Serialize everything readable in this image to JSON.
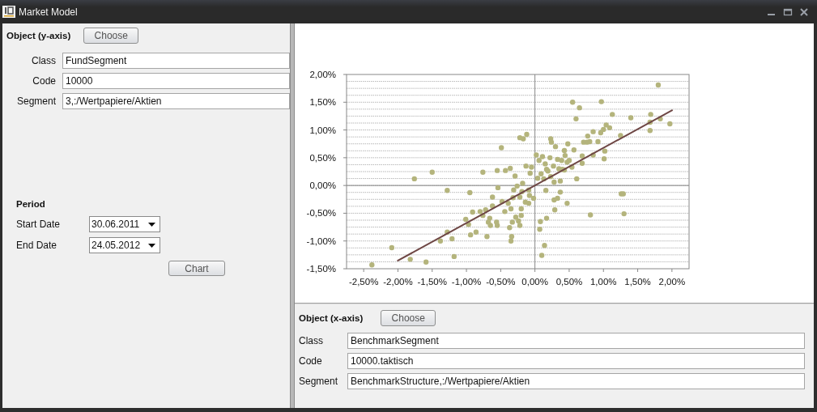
{
  "window": {
    "title": "Market Model"
  },
  "y_object": {
    "heading": "Object (y-axis)",
    "choose_button": "Choose",
    "fields": [
      {
        "label": "Class",
        "value": "FundSegment"
      },
      {
        "label": "Code",
        "value": "10000"
      },
      {
        "label": "Segment",
        "value": "3,:/Wertpapiere/Aktien"
      }
    ]
  },
  "period": {
    "heading": "Period",
    "fields": [
      {
        "label": "Start Date",
        "value": "30.06.2011"
      },
      {
        "label": "End Date",
        "value": "24.05.2012"
      }
    ],
    "chart_button": "Chart"
  },
  "chart_data": {
    "type": "scatter",
    "grid": true,
    "xlim": [
      -2.75,
      2.25
    ],
    "ylim": [
      -1.5,
      2.0
    ],
    "xticks": [
      {
        "value": -2.5,
        "label": "-2,50%"
      },
      {
        "value": -2.0,
        "label": "-2,00%"
      },
      {
        "value": -1.5,
        "label": "-1,50%"
      },
      {
        "value": -1.0,
        "label": "-1,00%"
      },
      {
        "value": -0.5,
        "label": "-0,50%"
      },
      {
        "value": 0,
        "label": "0,00%"
      },
      {
        "value": 0.5,
        "label": "0,50%"
      },
      {
        "value": 1.0,
        "label": "1,00%"
      },
      {
        "value": 1.5,
        "label": "1,50%"
      },
      {
        "value": 2.0,
        "label": "2,00%"
      }
    ],
    "yticks": [
      {
        "value": 2.0,
        "label": "2,00%"
      },
      {
        "value": 1.5,
        "label": "1,50%"
      },
      {
        "value": 1.0,
        "label": "1,00%"
      },
      {
        "value": 0.5,
        "label": "0,50%"
      },
      {
        "value": 0,
        "label": "0,00%"
      },
      {
        "value": -0.5,
        "label": "-0,50%"
      },
      {
        "value": -1.0,
        "label": "-1,00%"
      },
      {
        "value": -1.5,
        "label": "-1,50%"
      }
    ],
    "series": [
      {
        "type": "scatter",
        "color": "#b4b47c",
        "x": [
          1.8,
          0.55,
          0.97,
          0.65,
          0.6,
          1.13,
          1.4,
          1.69,
          1.83,
          1.97,
          1.68,
          1.68,
          1.25,
          1.04,
          1.09,
          1.0,
          0.96,
          0.85,
          0.77,
          0.76,
          0.8,
          0.92,
          0.71,
          0.85,
          1.01,
          1.02,
          0.48,
          0.23,
          0.3,
          0.57,
          0.43,
          0.44,
          0.69,
          0.69,
          0.54,
          0.24,
          0.02,
          0.11,
          0.22,
          0.33,
          0.39,
          0.47,
          0.15,
          0.27,
          0.35,
          0.43,
          0.19,
          0.09,
          0.04,
          0.13,
          0.23,
          0.61,
          0.37,
          0.28,
          -0.05,
          -0.13,
          -0.07,
          -0.12,
          -0.22,
          -0.17,
          -0.49,
          -0.36,
          -0.43,
          -0.55,
          -0.76,
          -0.29,
          -0.18,
          -1.5,
          -1.76,
          -1.28,
          -0.95,
          -0.54,
          -0.26,
          -0.31,
          -0.19,
          -0.08,
          -0.02,
          -0.09,
          -0.22,
          -0.32,
          -0.39,
          -0.48,
          -0.62,
          -0.62,
          -0.72,
          -0.8,
          -0.91,
          -1.01,
          -0.97,
          -0.66,
          -0.56,
          -0.44,
          -0.35,
          -0.2,
          -0.24,
          -0.28,
          -0.37,
          -0.33,
          -0.22,
          -0.2,
          -0.65,
          -0.55,
          -0.76,
          -0.68,
          -0.86,
          -0.94,
          -0.7,
          -0.34,
          -0.35,
          -1.28,
          -1.21,
          -1.38,
          -1.18,
          -2.09,
          -1.82,
          -1.59,
          -2.38,
          0.16,
          0.37,
          0.28,
          0.33,
          0.47,
          0.29,
          0.08,
          0.17,
          0.07,
          0.14,
          0.1,
          0.81,
          1.26,
          1.29,
          1.3,
          0.4,
          0.5,
          0.06,
          0.17,
          -0.09,
          -0.14
        ],
        "values": [
          1.81,
          1.5,
          1.51,
          1.4,
          1.2,
          1.28,
          1.22,
          1.28,
          1.2,
          1.11,
          1.14,
          0.99,
          0.9,
          1.09,
          1.04,
          1.01,
          0.95,
          0.97,
          0.89,
          0.78,
          0.79,
          0.79,
          0.78,
          0.55,
          0.48,
          0.62,
          0.75,
          0.84,
          0.7,
          0.64,
          0.63,
          0.54,
          0.53,
          0.4,
          0.33,
          0.78,
          0.55,
          0.52,
          0.5,
          0.47,
          0.45,
          0.42,
          0.39,
          0.35,
          0.3,
          0.28,
          0.26,
          0.21,
          0.13,
          0.12,
          0.16,
          0.12,
          0.08,
          0.06,
          0.33,
          0.35,
          0.22,
          0.92,
          0.86,
          0.84,
          0.68,
          0.31,
          0.27,
          0.27,
          0.24,
          0.17,
          0.04,
          0.24,
          0.12,
          -0.09,
          -0.13,
          -0.04,
          -0.01,
          -0.08,
          -0.11,
          -0.18,
          -0.23,
          -0.32,
          -0.21,
          -0.22,
          -0.32,
          -0.29,
          -0.21,
          -0.37,
          -0.44,
          -0.47,
          -0.48,
          -0.61,
          -0.7,
          -0.59,
          -0.66,
          -0.47,
          -0.42,
          -0.42,
          -0.64,
          -0.57,
          -0.76,
          -0.66,
          -0.72,
          -0.54,
          -0.72,
          -0.72,
          -0.54,
          -0.66,
          -0.84,
          -0.89,
          -0.92,
          -0.92,
          -1.0,
          -0.84,
          -0.96,
          -1.0,
          -1.28,
          -1.12,
          -1.33,
          -1.38,
          -1.43,
          -0.09,
          -0.12,
          -0.26,
          -0.23,
          -0.32,
          -0.44,
          -0.65,
          -0.59,
          -0.79,
          -1.08,
          -1.26,
          -0.53,
          -0.15,
          -0.15,
          -0.51,
          0.29,
          0.45,
          0.45,
          0.29,
          -0.08,
          -0.3
        ]
      },
      {
        "type": "line",
        "color": "#6e4644",
        "x": [
          -2.01,
          2.01
        ],
        "values": [
          -1.36,
          1.36
        ]
      }
    ]
  },
  "x_object": {
    "heading": "Object (x-axis)",
    "choose_button": "Choose",
    "fields": [
      {
        "label": "Class",
        "value": "BenchmarkSegment"
      },
      {
        "label": "Code",
        "value": "10000.taktisch"
      },
      {
        "label": "Segment",
        "value": "BenchmarkStructure,:/Wertpapiere/Aktien"
      }
    ]
  }
}
